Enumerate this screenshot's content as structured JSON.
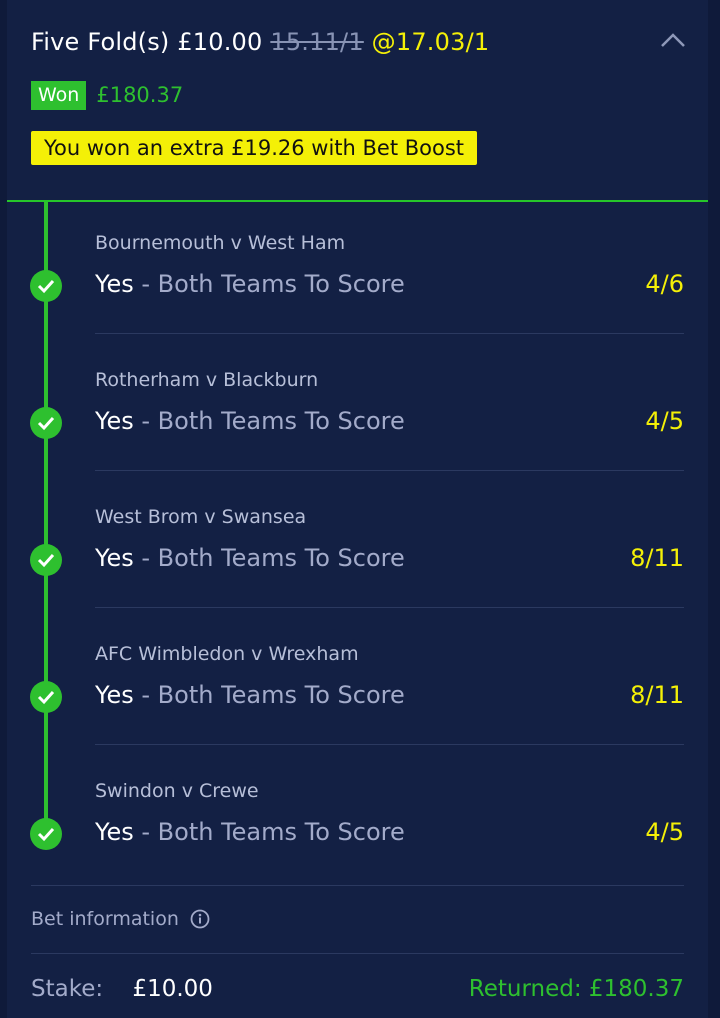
{
  "bet": {
    "type_stake": "Five Fold(s) £10.00",
    "old_odds": "15.11/1",
    "new_odds": "@17.03/1",
    "status": "Won",
    "won_amount": "£180.37",
    "boost_message": "You won an extra £19.26 with Bet Boost"
  },
  "selections": [
    {
      "event": "Bournemouth v West Ham",
      "pick": "Yes",
      "market": " - Both Teams To Score",
      "odds": "4/6"
    },
    {
      "event": "Rotherham v Blackburn",
      "pick": "Yes",
      "market": " - Both Teams To Score",
      "odds": "4/5"
    },
    {
      "event": "West Brom v Swansea",
      "pick": "Yes",
      "market": " - Both Teams To Score",
      "odds": "8/11"
    },
    {
      "event": "AFC Wimbledon v Wrexham",
      "pick": "Yes",
      "market": " - Both Teams To Score",
      "odds": "8/11"
    },
    {
      "event": "Swindon v Crewe",
      "pick": "Yes",
      "market": " - Both Teams To Score",
      "odds": "4/5"
    }
  ],
  "info": {
    "bet_information_label": "Bet information",
    "stake_label": "Stake:",
    "stake_value": "£10.00",
    "returned": "Returned: £180.37"
  },
  "icons": {
    "collapse": "chevron-up-icon",
    "selection_status": "checkmark-icon",
    "info": "info-icon"
  },
  "colors": {
    "background": "#132044",
    "won_green": "#2ec02f",
    "odds_yellow": "#f4f007"
  }
}
